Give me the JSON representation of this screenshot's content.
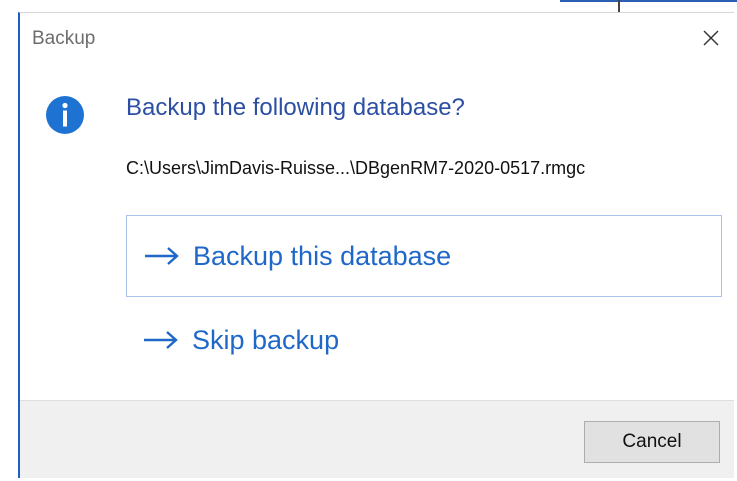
{
  "window": {
    "title": "Backup",
    "close_icon": "close-icon"
  },
  "message": {
    "icon": "info-icon",
    "heading": "Backup the following database?",
    "path": "C:\\Users\\JimDavis-Ruisse...\\DBgenRM7-2020-0517.rmgc"
  },
  "commands": [
    {
      "label": "Backup this database",
      "icon": "arrow-right-icon"
    },
    {
      "label": "Skip backup",
      "icon": "arrow-right-icon"
    }
  ],
  "footer": {
    "cancel_label": "Cancel"
  },
  "colors": {
    "accent": "#1f68c9",
    "heading": "#2d4fa3",
    "info_icon": "#1e73d2",
    "footer_bg": "#f0f0f0"
  }
}
